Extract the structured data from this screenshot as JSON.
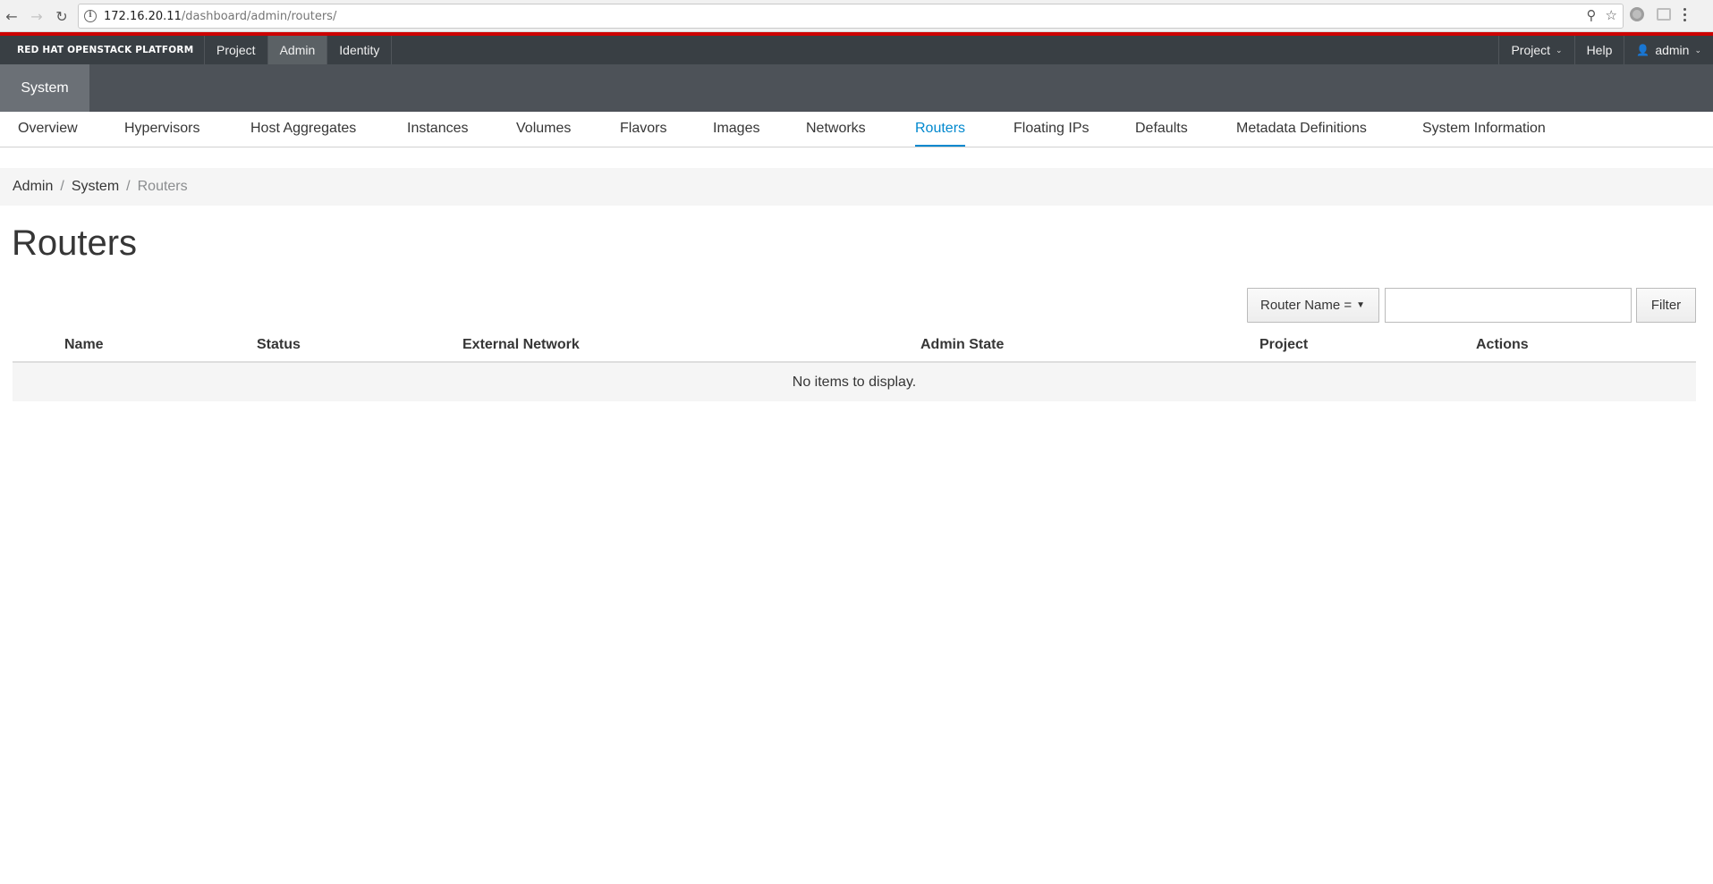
{
  "browser": {
    "url_host": "172.16.20.11",
    "url_path": "/dashboard/admin/routers/"
  },
  "masthead": {
    "brand": "RED HAT OPENSTACK PLATFORM",
    "dashboards": [
      {
        "label": "Project"
      },
      {
        "label": "Admin",
        "active": true
      },
      {
        "label": "Identity"
      }
    ],
    "project_menu": "Project",
    "help": "Help",
    "user": "admin"
  },
  "system_tab": "System",
  "panel_tabs": [
    {
      "label": "Overview"
    },
    {
      "label": "Hypervisors"
    },
    {
      "label": "Host Aggregates"
    },
    {
      "label": "Instances"
    },
    {
      "label": "Volumes"
    },
    {
      "label": "Flavors"
    },
    {
      "label": "Images"
    },
    {
      "label": "Networks"
    },
    {
      "label": "Routers",
      "active": true
    },
    {
      "label": "Floating IPs"
    },
    {
      "label": "Defaults"
    },
    {
      "label": "Metadata Definitions"
    },
    {
      "label": "System Information"
    }
  ],
  "breadcrumb": {
    "items": [
      "Admin",
      "System"
    ],
    "current": "Routers"
  },
  "page_title": "Routers",
  "filter": {
    "field_label": "Router Name =",
    "input_value": "",
    "button_label": "Filter"
  },
  "table": {
    "columns": [
      "Name",
      "Status",
      "External Network",
      "Admin State",
      "Project",
      "Actions"
    ],
    "empty_message": "No items to display."
  },
  "colors": {
    "accent": "#0088ce",
    "masthead": "#393f44",
    "brand_red": "#cc0000"
  }
}
